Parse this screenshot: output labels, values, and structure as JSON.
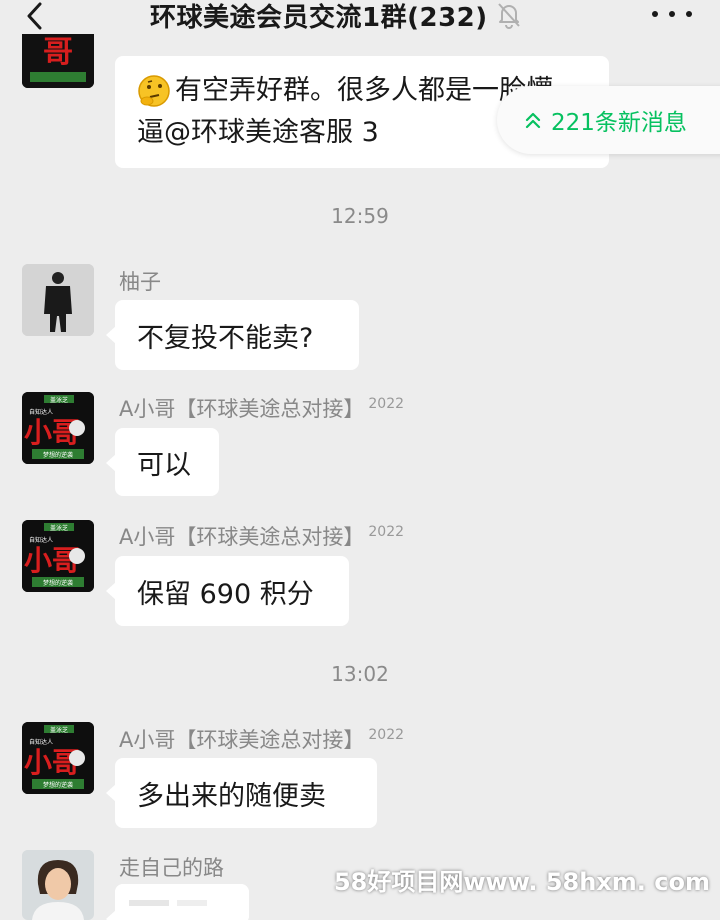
{
  "header": {
    "back_icon": "chevron-left-icon",
    "title": "环球美途会员交流1群(232)",
    "mute_icon": "bell-slash-icon",
    "more_icon": "ellipsis-icon"
  },
  "new_messages": {
    "icon": "double-chevron-up-icon",
    "label": "221条新消息"
  },
  "messages": [
    {
      "type": "text",
      "line1": "有空弄好群。很多人都是一脸懵",
      "line2": "逼@环球美途客服 3",
      "emoji": "thinking-face-emoji"
    },
    {
      "type": "time",
      "text": "12:59"
    },
    {
      "type": "text",
      "sender": "柚子",
      "text": "不复投不能卖?"
    },
    {
      "type": "text",
      "sender": "A小哥【环球美途总对接】",
      "badge": "2022",
      "text": "可以"
    },
    {
      "type": "text",
      "sender": "A小哥【环球美途总对接】",
      "badge": "2022",
      "text": "保留 690 积分"
    },
    {
      "type": "time",
      "text": "13:02"
    },
    {
      "type": "text",
      "sender": "A小哥【环球美途总对接】",
      "badge": "2022",
      "text": "多出来的随便卖"
    },
    {
      "type": "image",
      "sender": "走自己的路"
    }
  ],
  "avatar_text": {
    "top": "盖泳芝",
    "side": "自知达人",
    "big": "小哥",
    "bottom": "梦想的逆袭"
  },
  "watermark": "58好项目网www. 58hxm. com",
  "colors": {
    "background": "#ededed",
    "bubble": "#ffffff",
    "accent_green": "#07c160",
    "avatar_red": "#d81e1e"
  }
}
